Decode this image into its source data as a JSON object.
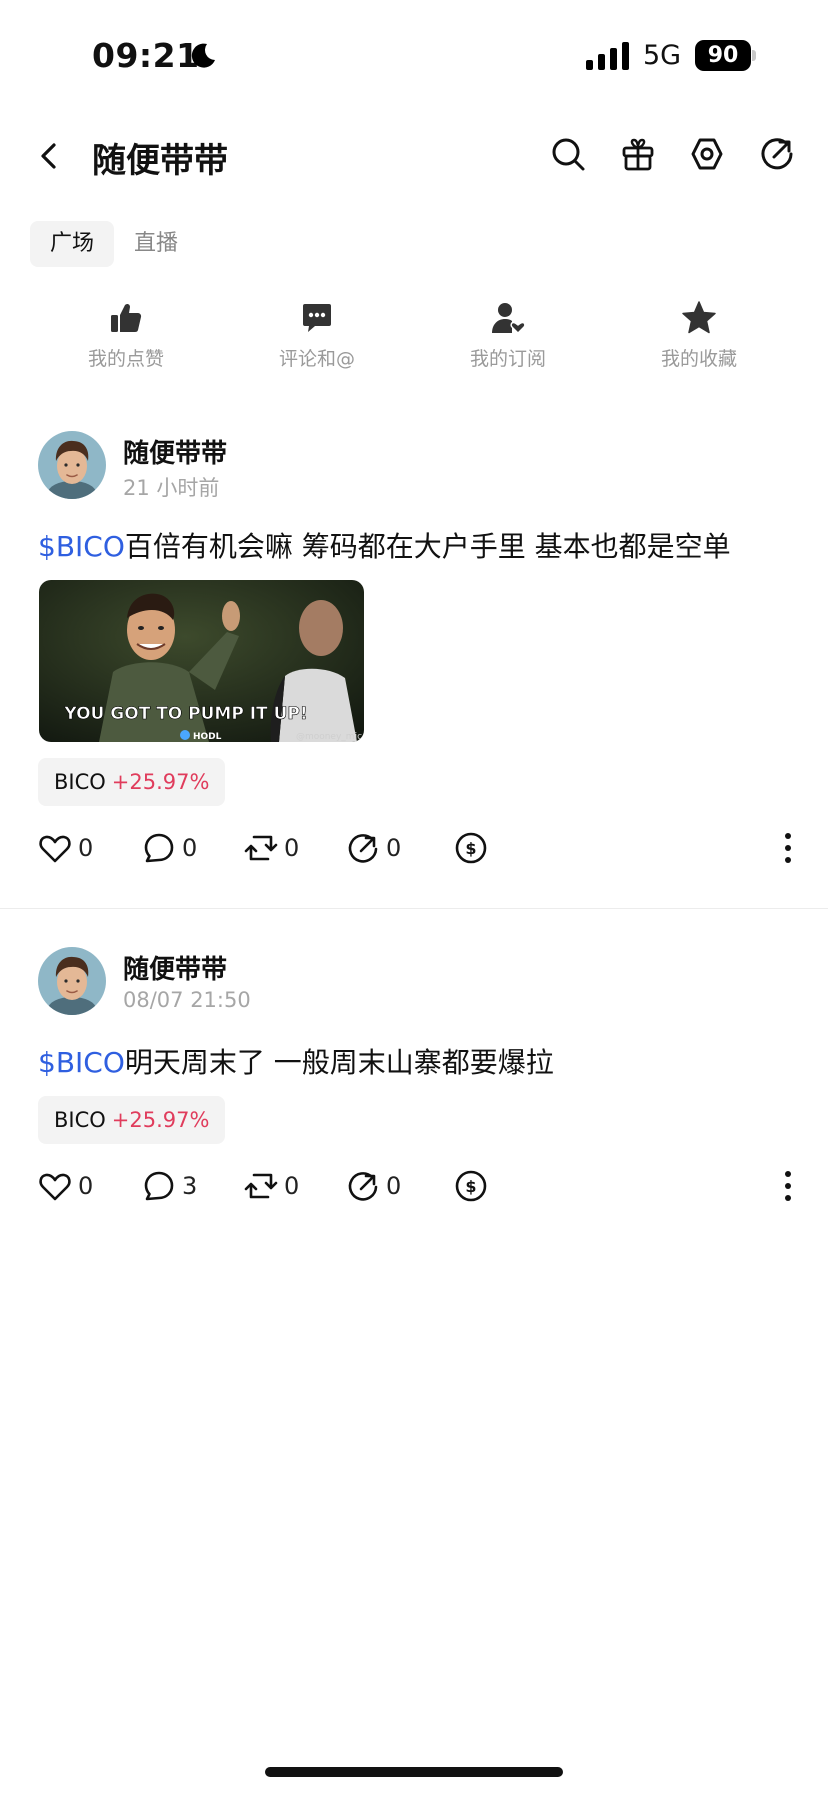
{
  "status_bar": {
    "time": "09:21",
    "network": "5G",
    "battery": "90"
  },
  "header": {
    "title": "随便带带",
    "back_icon": "chevron-left-icon",
    "icons": [
      "search-icon",
      "gift-icon",
      "settings-icon",
      "share-icon"
    ]
  },
  "tabs": [
    {
      "label": "广场",
      "active": true
    },
    {
      "label": "直播",
      "active": false
    }
  ],
  "quick_actions": [
    {
      "label": "我的点赞",
      "icon": "thumbs-up-icon"
    },
    {
      "label": "评论和@",
      "icon": "comment-icon"
    },
    {
      "label": "我的订阅",
      "icon": "subscribe-user-icon"
    },
    {
      "label": "我的收藏",
      "icon": "star-icon"
    }
  ],
  "posts": [
    {
      "author": "随便带带",
      "time": "21 小时前",
      "cashtag": "$BICO",
      "text": "百倍有机会嘛 筹码都在大户手里 基本也都是空单",
      "image": {
        "caption": "YOU GOT TO PUMP IT UP!",
        "badge": "HODL",
        "watermark": "@mooney_mic"
      },
      "tag": {
        "symbol": "BICO",
        "change": "+25.97%"
      },
      "actions": {
        "likes": "0",
        "comments": "0",
        "reposts": "0",
        "shares": "0"
      }
    },
    {
      "author": "随便带带",
      "time": "08/07 21:50",
      "cashtag": "$BICO",
      "text": "明天周末了 一般周末山寨都要爆拉",
      "tag": {
        "symbol": "BICO",
        "change": "+25.97%"
      },
      "actions": {
        "likes": "0",
        "comments": "3",
        "reposts": "0",
        "shares": "0"
      }
    }
  ],
  "colors": {
    "cashtag": "#2f5fe0",
    "positive_change": "#e03c5c",
    "chip_bg": "#f3f3f3"
  }
}
